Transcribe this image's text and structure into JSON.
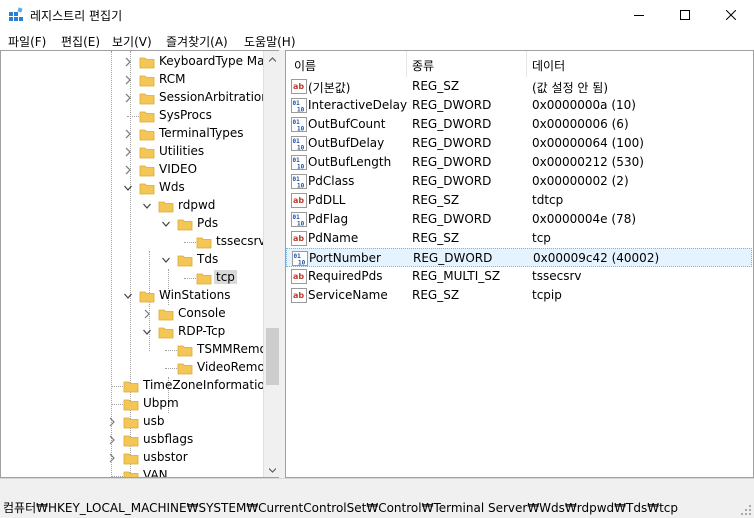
{
  "window": {
    "title": "레지스트리 편집기"
  },
  "menu": [
    {
      "label": "파일(F)"
    },
    {
      "label": "편집(E)"
    },
    {
      "label": "보기(V)"
    },
    {
      "label": "즐겨찾기(A)"
    },
    {
      "label": "도움말(H)"
    }
  ],
  "tree": [
    {
      "label": "KeyboardType Mapping",
      "expander": "collapsed"
    },
    {
      "label": "RCM",
      "expander": "collapsed"
    },
    {
      "label": "SessionArbitrationHelper",
      "expander": "collapsed"
    },
    {
      "label": "SysProcs",
      "expander": "none"
    },
    {
      "label": "TerminalTypes",
      "expander": "collapsed"
    },
    {
      "label": "Utilities",
      "expander": "collapsed"
    },
    {
      "label": "VIDEO",
      "expander": "collapsed"
    },
    {
      "label": "Wds",
      "expander": "expanded"
    },
    {
      "label": "rdpwd",
      "expander": "expanded"
    },
    {
      "label": "Pds",
      "expander": "expanded"
    },
    {
      "label": "tssecsrv",
      "expander": "none"
    },
    {
      "label": "Tds",
      "expander": "expanded"
    },
    {
      "label": "tcp",
      "expander": "none",
      "selected": true
    },
    {
      "label": "WinStations",
      "expander": "expanded"
    },
    {
      "label": "Console",
      "expander": "collapsed"
    },
    {
      "label": "RDP-Tcp",
      "expander": "expanded"
    },
    {
      "label": "TSMMRemotingAllowedApps",
      "expander": "none"
    },
    {
      "label": "VideoRemotingWindowNames",
      "expander": "none"
    },
    {
      "label": "TimeZoneInformation",
      "expander": "none"
    },
    {
      "label": "Ubpm",
      "expander": "none"
    },
    {
      "label": "usb",
      "expander": "collapsed"
    },
    {
      "label": "usbflags",
      "expander": "collapsed"
    },
    {
      "label": "usbstor",
      "expander": "collapsed"
    },
    {
      "label": "VAN",
      "expander": "none"
    }
  ],
  "columns": {
    "name": "이름",
    "type": "종류",
    "data": "데이터"
  },
  "values": [
    {
      "name": "(기본값)",
      "type": "REG_SZ",
      "data": "(값 설정 안 됨)",
      "icon": "string-value-icon"
    },
    {
      "name": "InteractiveDelay",
      "type": "REG_DWORD",
      "data": "0x0000000a (10)",
      "icon": "binary-value-icon"
    },
    {
      "name": "OutBufCount",
      "type": "REG_DWORD",
      "data": "0x00000006 (6)",
      "icon": "binary-value-icon"
    },
    {
      "name": "OutBufDelay",
      "type": "REG_DWORD",
      "data": "0x00000064 (100)",
      "icon": "binary-value-icon"
    },
    {
      "name": "OutBufLength",
      "type": "REG_DWORD",
      "data": "0x00000212 (530)",
      "icon": "binary-value-icon"
    },
    {
      "name": "PdClass",
      "type": "REG_DWORD",
      "data": "0x00000002 (2)",
      "icon": "binary-value-icon"
    },
    {
      "name": "PdDLL",
      "type": "REG_SZ",
      "data": "tdtcp",
      "icon": "string-value-icon"
    },
    {
      "name": "PdFlag",
      "type": "REG_DWORD",
      "data": "0x0000004e (78)",
      "icon": "binary-value-icon"
    },
    {
      "name": "PdName",
      "type": "REG_SZ",
      "data": "tcp",
      "icon": "string-value-icon"
    },
    {
      "name": "PortNumber",
      "type": "REG_DWORD",
      "data": "0x00009c42 (40002)",
      "icon": "binary-value-icon",
      "selected": true
    },
    {
      "name": "RequiredPds",
      "type": "REG_MULTI_SZ",
      "data": "tssecsrv",
      "icon": "string-value-icon"
    },
    {
      "name": "ServiceName",
      "type": "REG_SZ",
      "data": "tcpip",
      "icon": "string-value-icon"
    }
  ],
  "status": {
    "path": "컴퓨터₩HKEY_LOCAL_MACHINE₩SYSTEM₩CurrentControlSet₩Control₩Terminal Server₩Wds₩rdpwd₩Tds₩tcp"
  },
  "colors": {
    "folder": "#f3c655",
    "folder_dark": "#dcaa30",
    "selection": "#e5f3ff",
    "string_icon": "#c0392b",
    "binary_icon": "#1f4fa3"
  }
}
